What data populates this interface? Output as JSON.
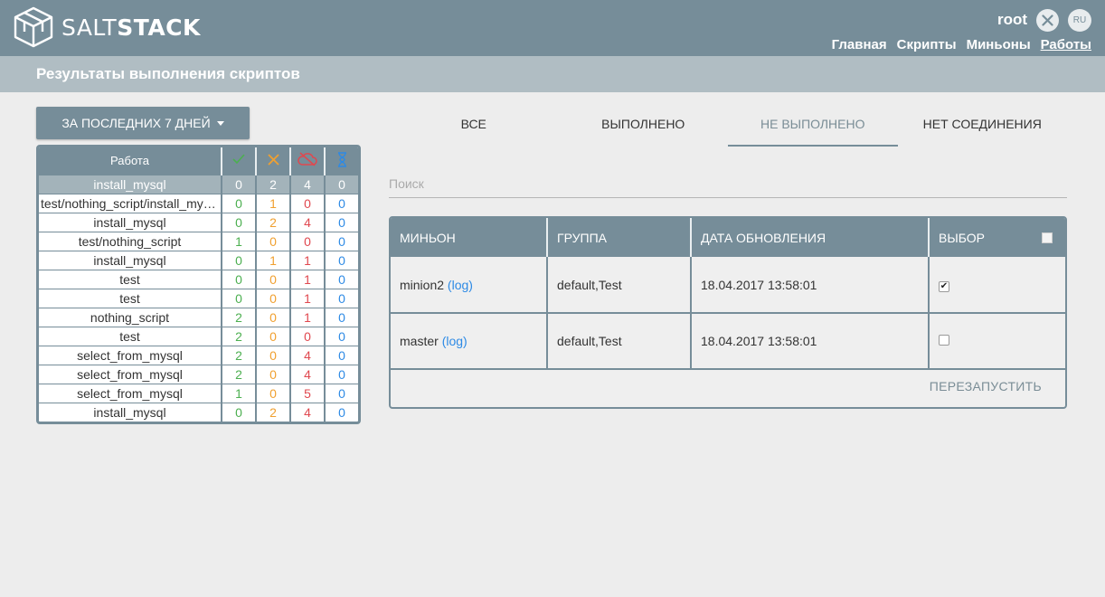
{
  "header": {
    "brand_light": "SALT",
    "brand_bold": "STACK",
    "user": "root",
    "lang": "RU",
    "nav": [
      {
        "label": "Главная",
        "active": false
      },
      {
        "label": "Скрипты",
        "active": false
      },
      {
        "label": "Миньоны",
        "active": false
      },
      {
        "label": "Работы",
        "active": true
      }
    ]
  },
  "page": {
    "title": "Результаты выполнения скриптов"
  },
  "period_button": "ЗА ПОСЛЕДНИХ 7 ДНЕЙ",
  "jobs_table": {
    "header": {
      "job": "Работа"
    },
    "header_icons": [
      "check-icon",
      "cross-icon",
      "cloud-offline-icon",
      "hourglass-icon"
    ],
    "rows": [
      {
        "name": "install_mysql",
        "ok": "0",
        "fail": "2",
        "noconn": "4",
        "wait": "0",
        "selected": true
      },
      {
        "name": "test/nothing_script/install_mysql",
        "ok": "0",
        "fail": "1",
        "noconn": "0",
        "wait": "0"
      },
      {
        "name": "install_mysql",
        "ok": "0",
        "fail": "2",
        "noconn": "4",
        "wait": "0"
      },
      {
        "name": "test/nothing_script",
        "ok": "1",
        "fail": "0",
        "noconn": "0",
        "wait": "0"
      },
      {
        "name": "install_mysql",
        "ok": "0",
        "fail": "1",
        "noconn": "1",
        "wait": "0"
      },
      {
        "name": "test",
        "ok": "0",
        "fail": "0",
        "noconn": "1",
        "wait": "0"
      },
      {
        "name": "test",
        "ok": "0",
        "fail": "0",
        "noconn": "1",
        "wait": "0"
      },
      {
        "name": "nothing_script",
        "ok": "2",
        "fail": "0",
        "noconn": "1",
        "wait": "0"
      },
      {
        "name": "test",
        "ok": "2",
        "fail": "0",
        "noconn": "0",
        "wait": "0"
      },
      {
        "name": "select_from_mysql",
        "ok": "2",
        "fail": "0",
        "noconn": "4",
        "wait": "0"
      },
      {
        "name": "select_from_mysql",
        "ok": "2",
        "fail": "0",
        "noconn": "4",
        "wait": "0"
      },
      {
        "name": "select_from_mysql",
        "ok": "1",
        "fail": "0",
        "noconn": "5",
        "wait": "0"
      },
      {
        "name": "install_mysql",
        "ok": "0",
        "fail": "2",
        "noconn": "4",
        "wait": "0"
      }
    ]
  },
  "tabs": [
    {
      "label": "ВСЕ",
      "active": false
    },
    {
      "label": "ВЫПОЛНЕНО",
      "active": false
    },
    {
      "label": "НЕ ВЫПОЛНЕНО",
      "active": true
    },
    {
      "label": "НЕТ СОЕДИНЕНИЯ",
      "active": false
    }
  ],
  "search": {
    "placeholder": "Поиск",
    "value": ""
  },
  "results_table": {
    "columns": [
      "МИНЬОН",
      "ГРУППА",
      "ДАТА ОБНОВЛЕНИЯ",
      "ВЫБОР"
    ],
    "rows": [
      {
        "minion": "minion2",
        "log": "(log)",
        "group": "default,Test",
        "date": "18.04.2017 13:58:01",
        "checked": true
      },
      {
        "minion": "master",
        "log": "(log)",
        "group": "default,Test",
        "date": "18.04.2017 13:58:01",
        "checked": false
      }
    ],
    "restart_label": "ПЕРЕЗАПУСТИТЬ"
  },
  "colors": {
    "header": "#768d99",
    "subheader": "#b0bdc3",
    "ok": "#4caf50",
    "fail": "#f0a030",
    "noconn": "#e0484f",
    "wait": "#2d8ae5"
  }
}
